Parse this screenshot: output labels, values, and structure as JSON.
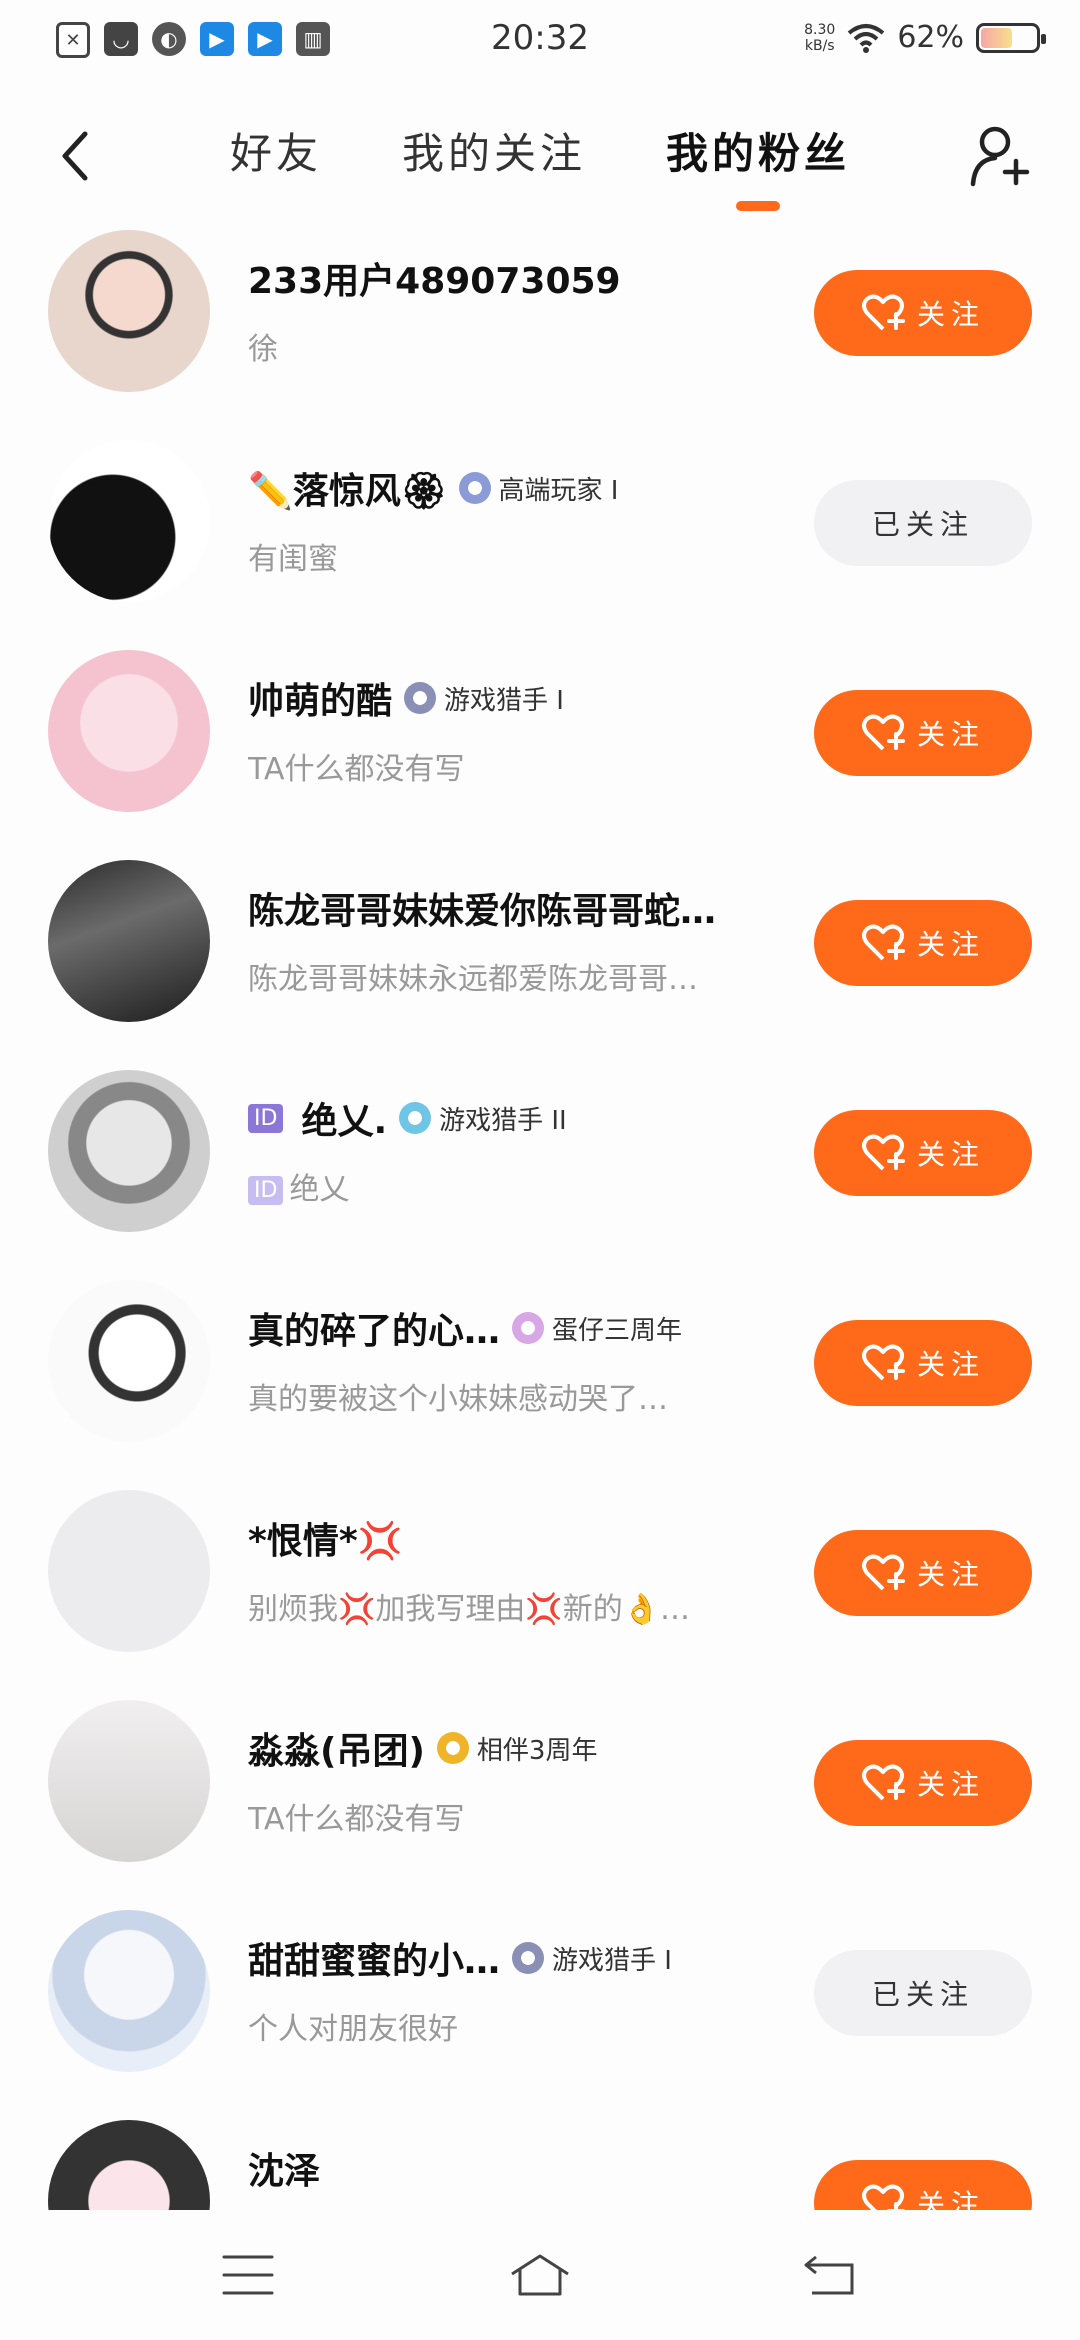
{
  "status_bar": {
    "time": "20:32",
    "net_speed_value": "8.30",
    "net_speed_unit": "kB/s",
    "battery": "62%",
    "battery_level": 0.62,
    "notification_icons": [
      "sim-icon",
      "mail-icon",
      "leaf-icon",
      "bookmark-icon",
      "bookmark-icon",
      "book-icon"
    ]
  },
  "header": {
    "tabs": [
      {
        "label": "好友"
      },
      {
        "label": "我的关注"
      },
      {
        "label": "我的粉丝"
      }
    ],
    "active_tab": 2,
    "accent_color": "#ff6a1a"
  },
  "buttons": {
    "follow_label": "关注",
    "followed_label": "已关注"
  },
  "fans": [
    {
      "name": "233用户489073059",
      "badge": "",
      "subtitle": "徐",
      "status": "follow"
    },
    {
      "name": "✏️落惊风🏵",
      "badge": "高端玩家 I",
      "subtitle": "有闺蜜",
      "status": "followed"
    },
    {
      "name": "帅萌的酷",
      "badge": "游戏猎手 I",
      "subtitle": "TA什么都没有写",
      "status": "follow"
    },
    {
      "name": "陈龙哥哥妹妹爱你陈哥哥蛇…",
      "badge": "",
      "subtitle": "陈龙哥哥妹妹永远都爱陈龙哥哥…",
      "status": "follow"
    },
    {
      "name": "绝乂.",
      "badge": "游戏猎手 II",
      "subtitle": "绝乂",
      "status": "follow",
      "id_tag": "ID"
    },
    {
      "name": "真的碎了的心…",
      "badge": "蛋仔三周年",
      "subtitle": "真的要被这个小妹妹感动哭了…",
      "status": "follow"
    },
    {
      "name": "*恨情*💢",
      "badge": "",
      "subtitle": "别烦我💢加我写理由💢新的👌…",
      "status": "follow"
    },
    {
      "name": "淼淼(吊团)",
      "badge": "相伴3周年",
      "subtitle": "TA什么都没有写",
      "status": "follow"
    },
    {
      "name": "甜甜蜜蜜的小…",
      "badge": "游戏猎手 I",
      "subtitle": "个人对朋友很好",
      "status": "followed"
    },
    {
      "name": "沈泽",
      "badge": "",
      "subtitle": "",
      "status": "follow"
    }
  ]
}
